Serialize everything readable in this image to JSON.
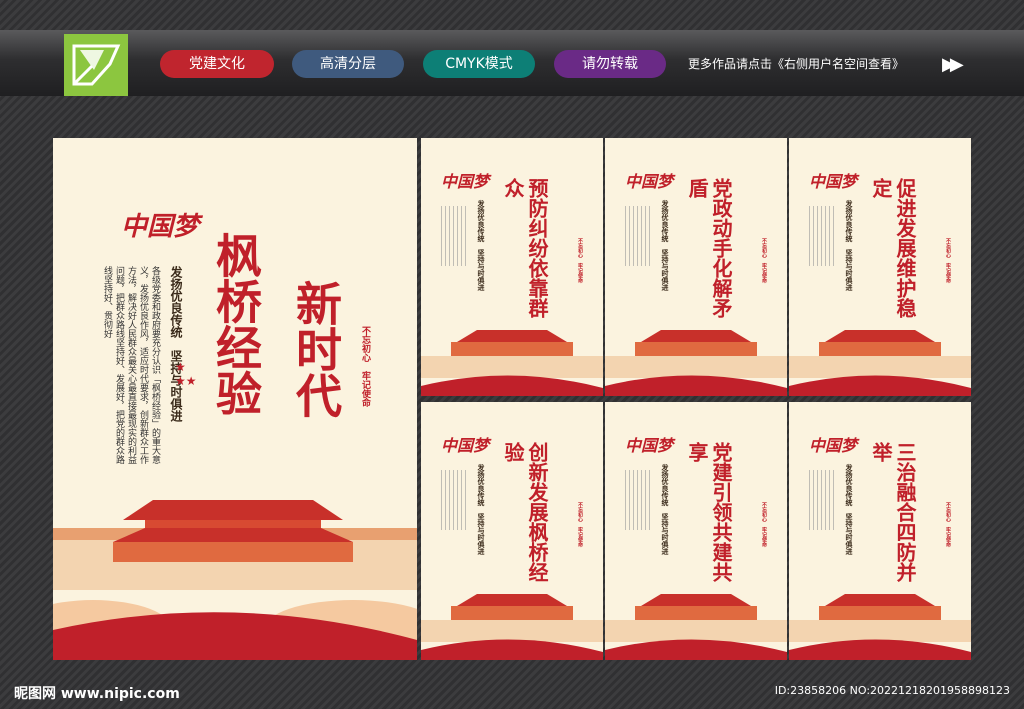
{
  "header": {
    "tags": [
      "党建文化",
      "高清分层",
      "CMYK模式",
      "请勿转载"
    ],
    "more_text": "更多作品请点击《右侧用户名空间查看》",
    "arrow_icon": "double-chevron-right-icon"
  },
  "main_poster": {
    "dream_text": "中国梦",
    "title_main": "枫桥经验",
    "title_sub": "新时代",
    "slogan": "发扬优良传统　坚持与时俱进",
    "body": "各级党委和政府要充分认识「枫桥经验」的重大意义，发扬优良作风，适应时代要求，创新群众工作方法，解决好人民群众最关心最直接最现实的利益问题，把群众路线坚持好、发展好，把党的群众路线坚持好、贯彻好",
    "seal": "不忘初心　牢记使命"
  },
  "small_posters": [
    {
      "title": "预防纠纷依靠群众"
    },
    {
      "title": "党政动手化解矛盾"
    },
    {
      "title": "促进发展维护稳定"
    },
    {
      "title": "创新发展枫桥经验"
    },
    {
      "title": "党建引领共建共享"
    },
    {
      "title": "三治融合四防并举"
    }
  ],
  "small_common": {
    "slogan": "发扬优良传统　坚持与时俱进",
    "seal": "不忘初心　牢记使命"
  },
  "footer": {
    "site": "昵图网 www.nipic.com",
    "id_text": "ID:23858206 NO:20221218201958898123"
  },
  "colors": {
    "accent": "#c0202a",
    "paper": "#fbf3df",
    "logo": "#8cc63f"
  }
}
